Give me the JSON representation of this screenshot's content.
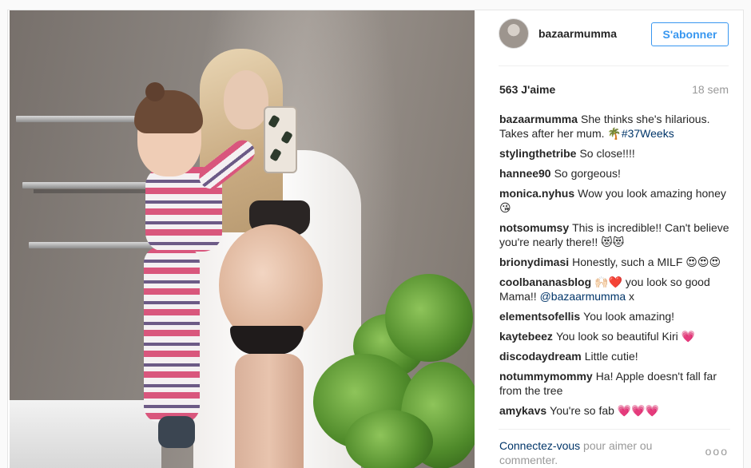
{
  "post": {
    "username": "bazaarmumma",
    "follow_label": "S'abonner",
    "likes": "563 J'aime",
    "age": "18 sem"
  },
  "comments": [
    {
      "user": "bazaarmumma",
      "text": "She thinks she's hilarious. Takes after her mum. 🌴",
      "tag": "#37Weeks"
    },
    {
      "user": "stylingthetribe",
      "text": "So close!!!!"
    },
    {
      "user": "hannee90",
      "text": "So gorgeous!"
    },
    {
      "user": "monica.nyhus",
      "text": "Wow you look amazing honey 😘"
    },
    {
      "user": "notsomumsy",
      "text": "This is incredible!! Can't believe you're nearly there!! 😻😻"
    },
    {
      "user": "brionydimasi",
      "text": "Honestly, such a MILF 😍😍😍"
    },
    {
      "user": "coolbananasblog",
      "text": "🙌🏻❤️ you look so good Mama!! ",
      "mention": "@bazaarmumma",
      "after": " x"
    },
    {
      "user": "elementsofellis",
      "text": "You look amazing!"
    },
    {
      "user": "kaytebeez",
      "text": "You look so beautiful Kiri 💗"
    },
    {
      "user": "discodaydream",
      "text": "Little cutie!"
    },
    {
      "user": "notummymommy",
      "text": "Ha! Apple doesn't fall far from the tree"
    },
    {
      "user": "amykavs",
      "text": "You're so fab 💗💗💗"
    },
    {
      "user": "...",
      "text": "..."
    }
  ],
  "footer": {
    "login_link": "Connectez-vous",
    "login_rest": " pour aimer ou commenter.",
    "more_label": "ooo"
  }
}
